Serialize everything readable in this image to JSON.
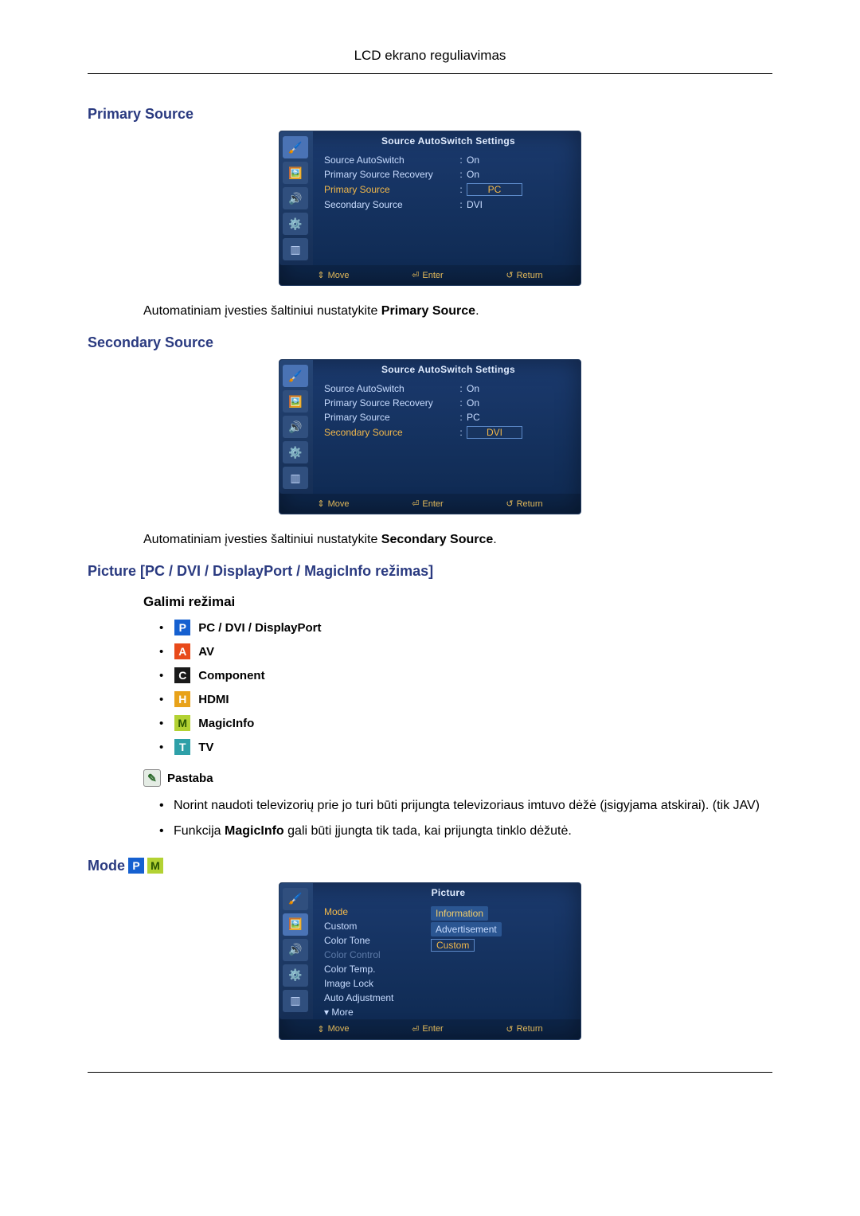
{
  "header": "LCD ekrano reguliavimas",
  "sections": {
    "primary": {
      "title": "Primary Source",
      "osd": {
        "title": "Source AutoSwitch Settings",
        "rows": [
          {
            "label": "Source AutoSwitch",
            "value": "On",
            "highlight": false,
            "boxed": false
          },
          {
            "label": "Primary Source Recovery",
            "value": "On",
            "highlight": false,
            "boxed": false
          },
          {
            "label": "Primary Source",
            "value": "PC",
            "highlight": true,
            "boxed": true
          },
          {
            "label": "Secondary Source",
            "value": "DVI",
            "highlight": false,
            "boxed": false
          }
        ],
        "footer": {
          "move": "Move",
          "enter": "Enter",
          "return": "Return"
        }
      },
      "caption_pre": "Automatiniam įvesties šaltiniui nustatykite ",
      "caption_bold": "Primary Source",
      "caption_post": "."
    },
    "secondary": {
      "title": "Secondary Source",
      "osd": {
        "title": "Source AutoSwitch Settings",
        "rows": [
          {
            "label": "Source AutoSwitch",
            "value": "On",
            "highlight": false,
            "boxed": false
          },
          {
            "label": "Primary Source Recovery",
            "value": "On",
            "highlight": false,
            "boxed": false
          },
          {
            "label": "Primary Source",
            "value": "PC",
            "highlight": false,
            "boxed": false
          },
          {
            "label": "Secondary Source",
            "value": "DVI",
            "highlight": true,
            "boxed": true
          }
        ],
        "footer": {
          "move": "Move",
          "enter": "Enter",
          "return": "Return"
        }
      },
      "caption_pre": "Automatiniam įvesties šaltiniui nustatykite ",
      "caption_bold": "Secondary Source",
      "caption_post": "."
    },
    "picture": {
      "title": "Picture [PC / DVI / DisplayPort / MagicInfo režimas]",
      "sub_title": "Galimi režimai",
      "modes": [
        {
          "badge": "P",
          "cls": "bP",
          "label": "PC / DVI / DisplayPort"
        },
        {
          "badge": "A",
          "cls": "bA",
          "label": "AV"
        },
        {
          "badge": "C",
          "cls": "bC",
          "label": "Component"
        },
        {
          "badge": "H",
          "cls": "bH",
          "label": "HDMI"
        },
        {
          "badge": "M",
          "cls": "bM",
          "label": "MagicInfo"
        },
        {
          "badge": "T",
          "cls": "bT",
          "label": "TV"
        }
      ],
      "note_label": "Pastaba",
      "notes": [
        "Norint naudoti televizorių prie jo turi būti prijungta televizoriaus imtuvo dėžė (įsigyjama atskirai). (tik JAV)",
        {
          "pre": "Funkcija ",
          "bold": "MagicInfo",
          "post": " gali būti įjungta tik tada, kai prijungta tinklo dėžutė."
        }
      ]
    },
    "mode": {
      "title": "Mode",
      "osd": {
        "title": "Picture",
        "menu": [
          {
            "label": "Mode",
            "highlight": true
          },
          {
            "label": "Custom"
          },
          {
            "label": "Color Tone"
          },
          {
            "label": "Color Control",
            "dim": true
          },
          {
            "label": "Color Temp."
          },
          {
            "label": "Image Lock"
          },
          {
            "label": "Auto Adjustment"
          },
          {
            "label": "▾ More"
          }
        ],
        "options": [
          {
            "label": "Information",
            "sel": true
          },
          {
            "label": "Advertisement"
          },
          {
            "label": "Custom",
            "boxed": true
          }
        ],
        "footer": {
          "move": "Move",
          "enter": "Enter",
          "return": "Return"
        }
      }
    }
  }
}
